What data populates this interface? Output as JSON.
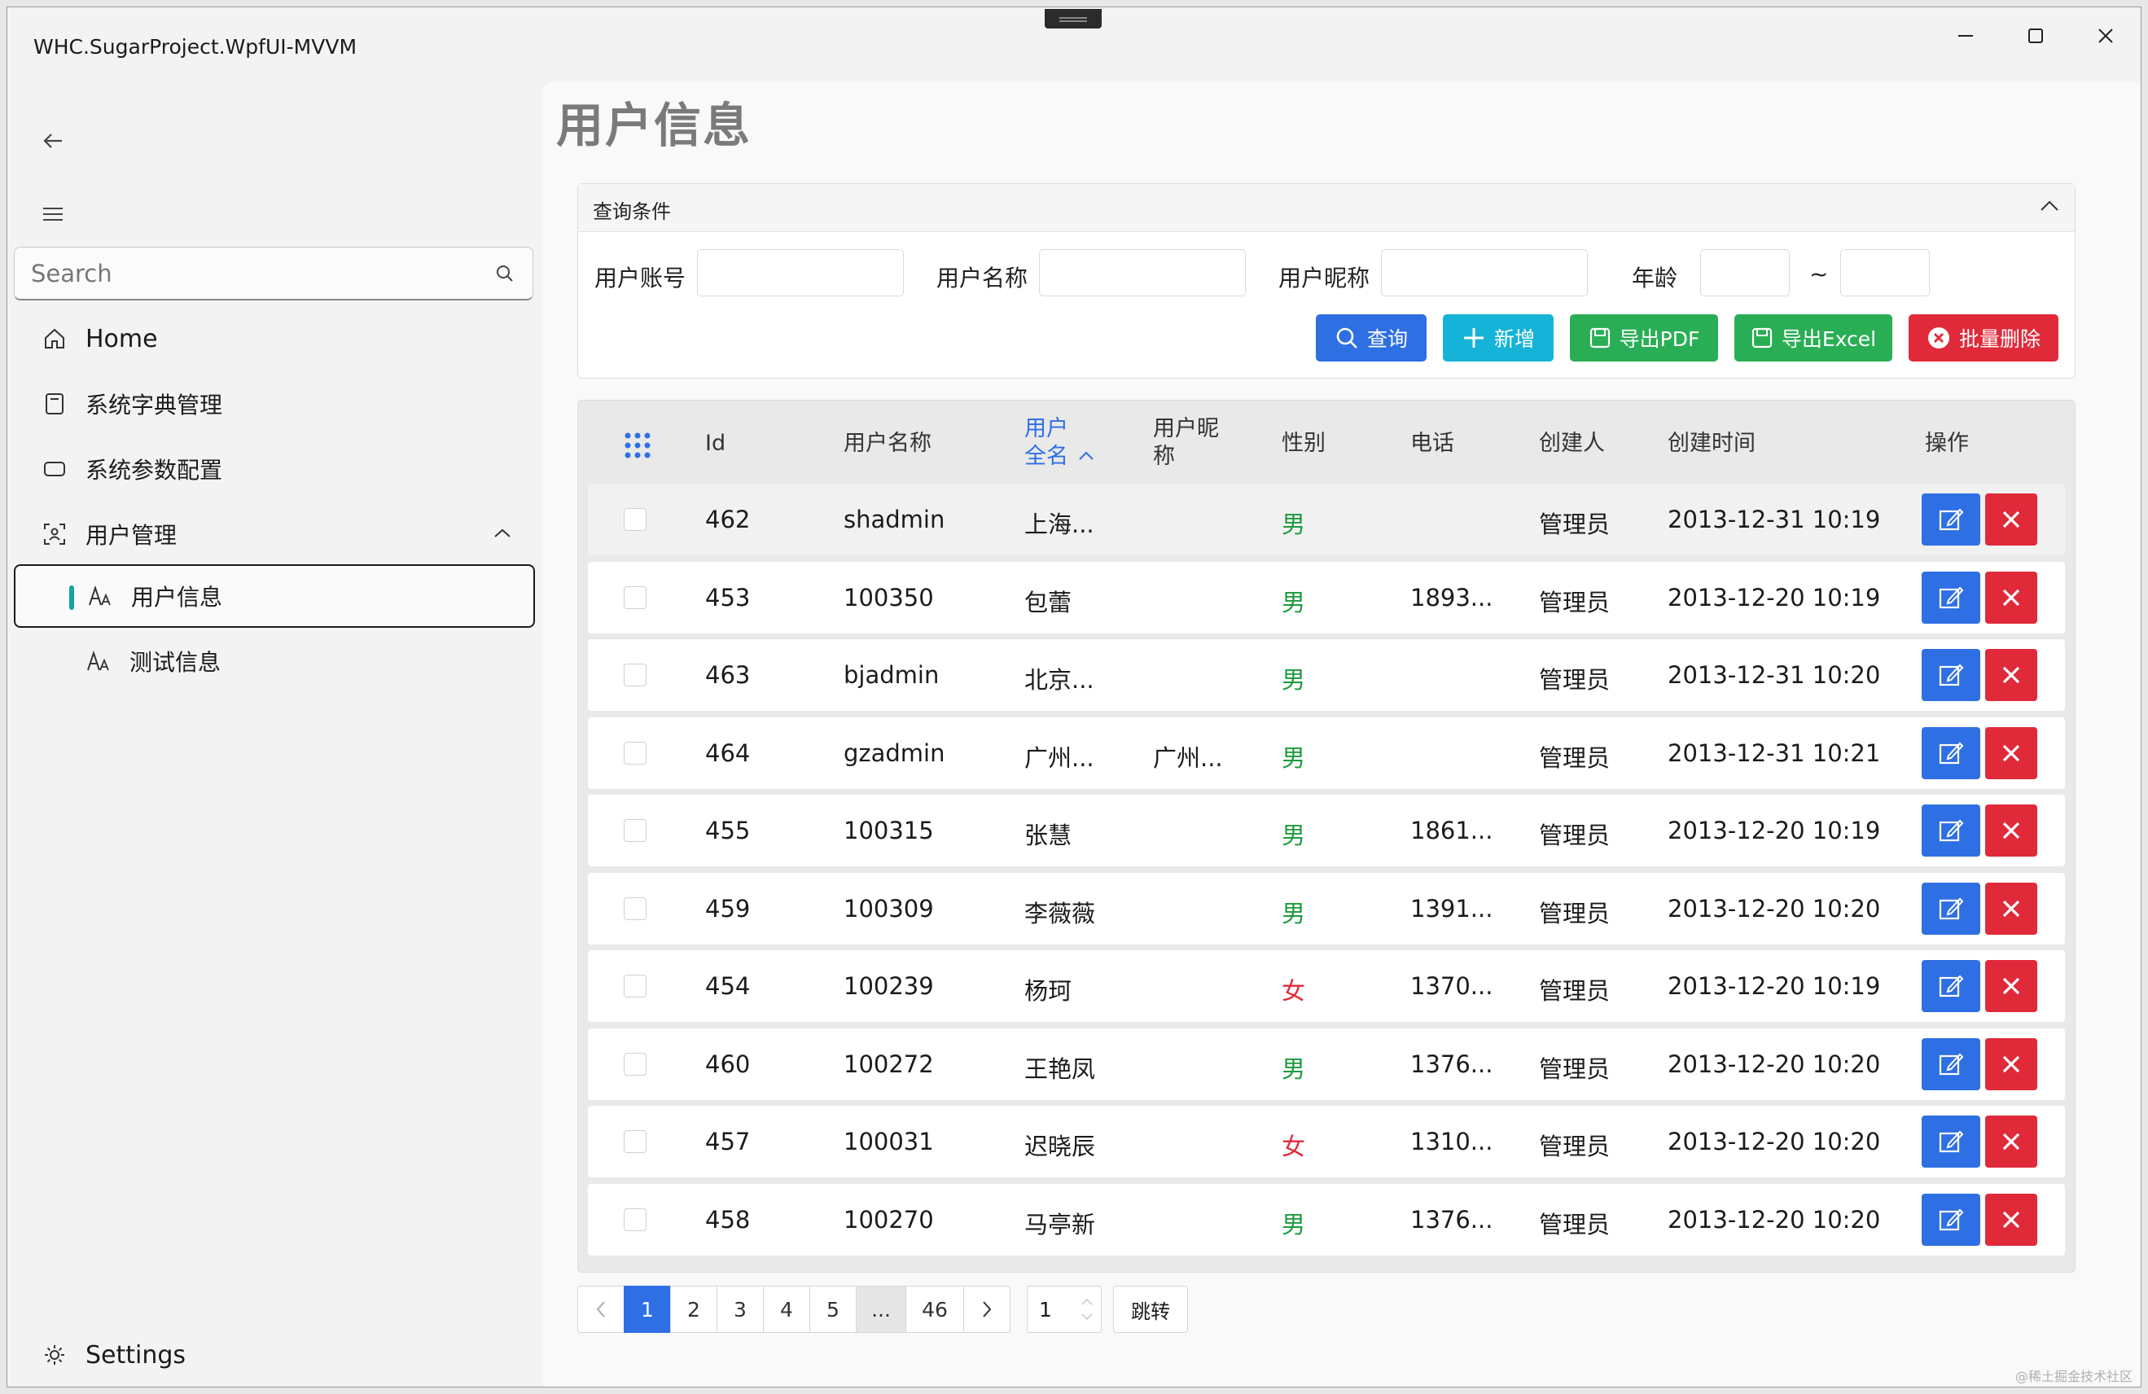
{
  "window": {
    "title": "WHC.SugarProject.WpfUI-MVVM"
  },
  "sidebar": {
    "search_placeholder": "Search",
    "items": [
      {
        "label": "Home",
        "icon": "home-icon"
      },
      {
        "label": "系统字典管理",
        "icon": "book-icon"
      },
      {
        "label": "系统参数配置",
        "icon": "rectangle-icon"
      },
      {
        "label": "用户管理",
        "icon": "user-group-icon",
        "expanded": true
      },
      {
        "label": "用户信息",
        "icon": "text-a-icon",
        "selected": true
      },
      {
        "label": "测试信息",
        "icon": "text-a-icon"
      }
    ],
    "settings_label": "Settings"
  },
  "page": {
    "title": "用户信息"
  },
  "query": {
    "header": "查询条件",
    "fields": [
      {
        "label": "用户账号",
        "value": ""
      },
      {
        "label": "用户名称",
        "value": ""
      },
      {
        "label": "用户昵称",
        "value": ""
      },
      {
        "label": "年龄",
        "value_from": "",
        "value_to": "",
        "separator": "~"
      }
    ],
    "buttons": {
      "search": "查询",
      "add": "新增",
      "pdf": "导出PDF",
      "excel": "导出Excel",
      "batch_delete": "批量删除"
    }
  },
  "table": {
    "columns": {
      "id": "Id",
      "name": "用户名称",
      "fullname_1": "用户",
      "fullname_2": "全名",
      "nickname_1": "用户昵",
      "nickname_2": "称",
      "gender": "性别",
      "phone": "电话",
      "creator": "创建人",
      "created": "创建时间",
      "actions": "操作"
    },
    "rows": [
      {
        "id": "462",
        "name": "shadmin",
        "fullname": "上海...",
        "nickname": "",
        "gender": "男",
        "phone": "",
        "creator": "管理员",
        "created": "2013-12-31 10:19"
      },
      {
        "id": "453",
        "name": "100350",
        "fullname": "包蕾",
        "nickname": "",
        "gender": "男",
        "phone": "1893...",
        "creator": "管理员",
        "created": "2013-12-20 10:19"
      },
      {
        "id": "463",
        "name": "bjadmin",
        "fullname": "北京...",
        "nickname": "",
        "gender": "男",
        "phone": "",
        "creator": "管理员",
        "created": "2013-12-31 10:20"
      },
      {
        "id": "464",
        "name": "gzadmin",
        "fullname": "广州...",
        "nickname": "广州...",
        "gender": "男",
        "phone": "",
        "creator": "管理员",
        "created": "2013-12-31 10:21"
      },
      {
        "id": "455",
        "name": "100315",
        "fullname": "张慧",
        "nickname": "",
        "gender": "男",
        "phone": "1861...",
        "creator": "管理员",
        "created": "2013-12-20 10:19"
      },
      {
        "id": "459",
        "name": "100309",
        "fullname": "李薇薇",
        "nickname": "",
        "gender": "男",
        "phone": "1391...",
        "creator": "管理员",
        "created": "2013-12-20 10:20"
      },
      {
        "id": "454",
        "name": "100239",
        "fullname": "杨珂",
        "nickname": "",
        "gender": "女",
        "phone": "1370...",
        "creator": "管理员",
        "created": "2013-12-20 10:19"
      },
      {
        "id": "460",
        "name": "100272",
        "fullname": "王艳凤",
        "nickname": "",
        "gender": "男",
        "phone": "1376...",
        "creator": "管理员",
        "created": "2013-12-20 10:20"
      },
      {
        "id": "457",
        "name": "100031",
        "fullname": "迟晓辰",
        "nickname": "",
        "gender": "女",
        "phone": "1310...",
        "creator": "管理员",
        "created": "2013-12-20 10:20"
      },
      {
        "id": "458",
        "name": "100270",
        "fullname": "马亭新",
        "nickname": "",
        "gender": "男",
        "phone": "1376...",
        "creator": "管理员",
        "created": "2013-12-20 10:20"
      }
    ]
  },
  "pagination": {
    "pages": [
      "1",
      "2",
      "3",
      "4",
      "5",
      "...",
      "46"
    ],
    "current": "1",
    "jump_value": "1",
    "jump_label": "跳转"
  },
  "watermark": "@稀土掘金技术社区",
  "colors": {
    "primary": "#2f6fe4",
    "cyan": "#15b3d7",
    "success": "#2aae55",
    "danger": "#e02a3a",
    "male": "#1c9a3c",
    "female": "#e02a3a"
  }
}
